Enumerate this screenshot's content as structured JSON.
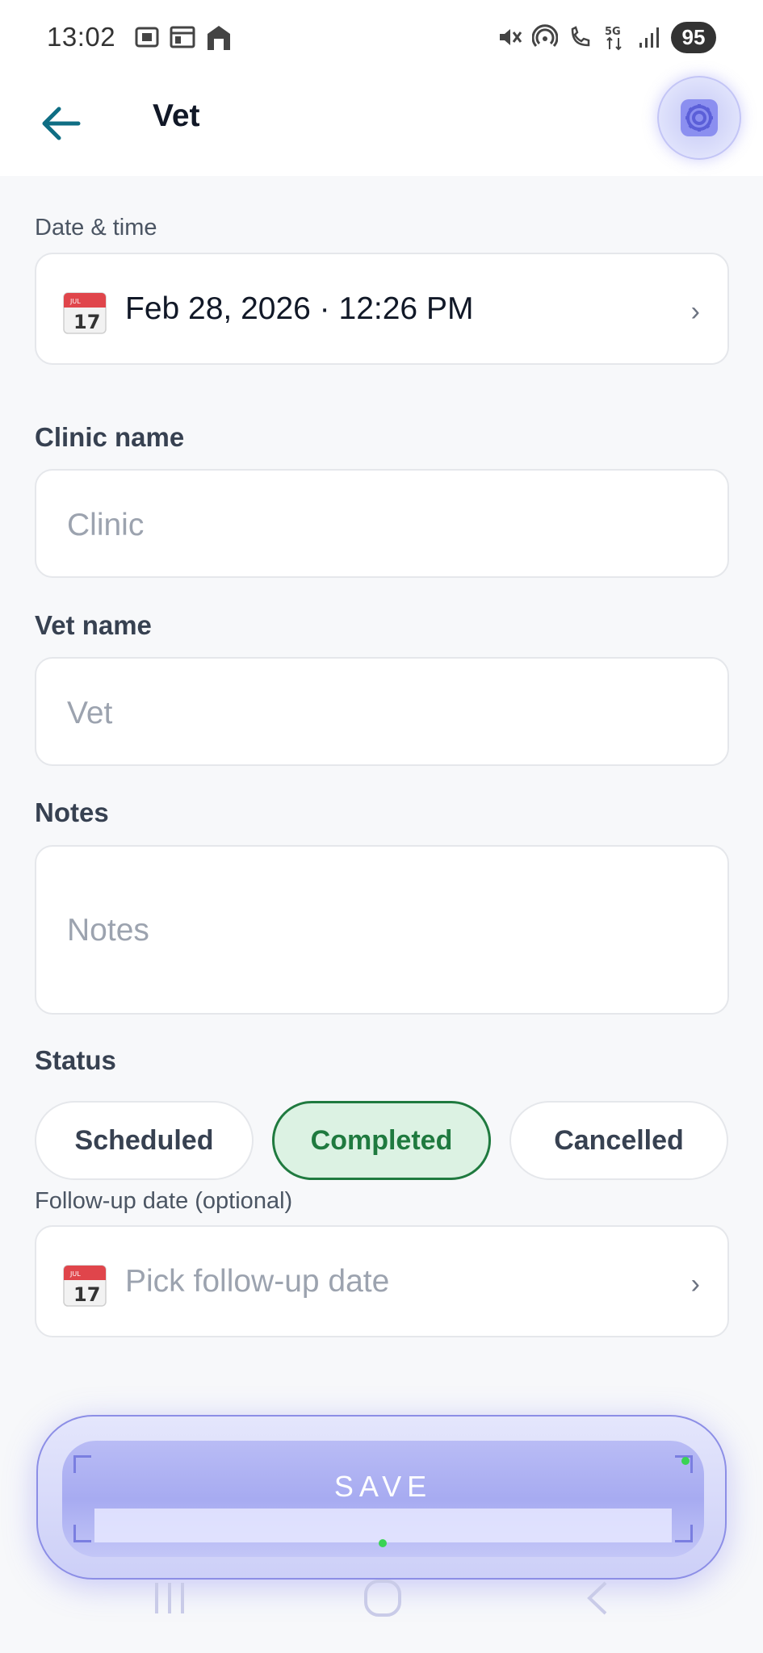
{
  "status_bar": {
    "time": "13:02",
    "battery": "95",
    "network": "5G"
  },
  "app_bar": {
    "title": "Vet",
    "back_icon": "arrow-left-icon",
    "settings_icon": "gear-icon"
  },
  "form": {
    "date_time": {
      "label": "Date & time",
      "value": "Feb 28, 2026 · 12:26 PM",
      "icon": "calendar-icon",
      "calendar_month": "JUL",
      "calendar_day": "17"
    },
    "clinic": {
      "label": "Clinic name",
      "placeholder": "Clinic"
    },
    "vet": {
      "label": "Vet name",
      "placeholder": "Vet"
    },
    "notes": {
      "label": "Notes",
      "placeholder": "Notes"
    },
    "status": {
      "label": "Status",
      "options": [
        "Scheduled",
        "Completed",
        "Cancelled"
      ],
      "selected": "Completed"
    },
    "follow_up": {
      "label": "Follow-up date (optional)",
      "placeholder": "Pick follow-up date",
      "icon": "calendar-icon",
      "calendar_month": "JUL",
      "calendar_day": "17"
    }
  },
  "save_button": {
    "label": "SAVE"
  },
  "colors": {
    "accent_teal": "#0f6e84",
    "status_active_bg": "#dcf2e3",
    "status_active_text": "#1f7a3f",
    "save_glow": "#a7abf1",
    "calendar_red": "#e0454b"
  }
}
